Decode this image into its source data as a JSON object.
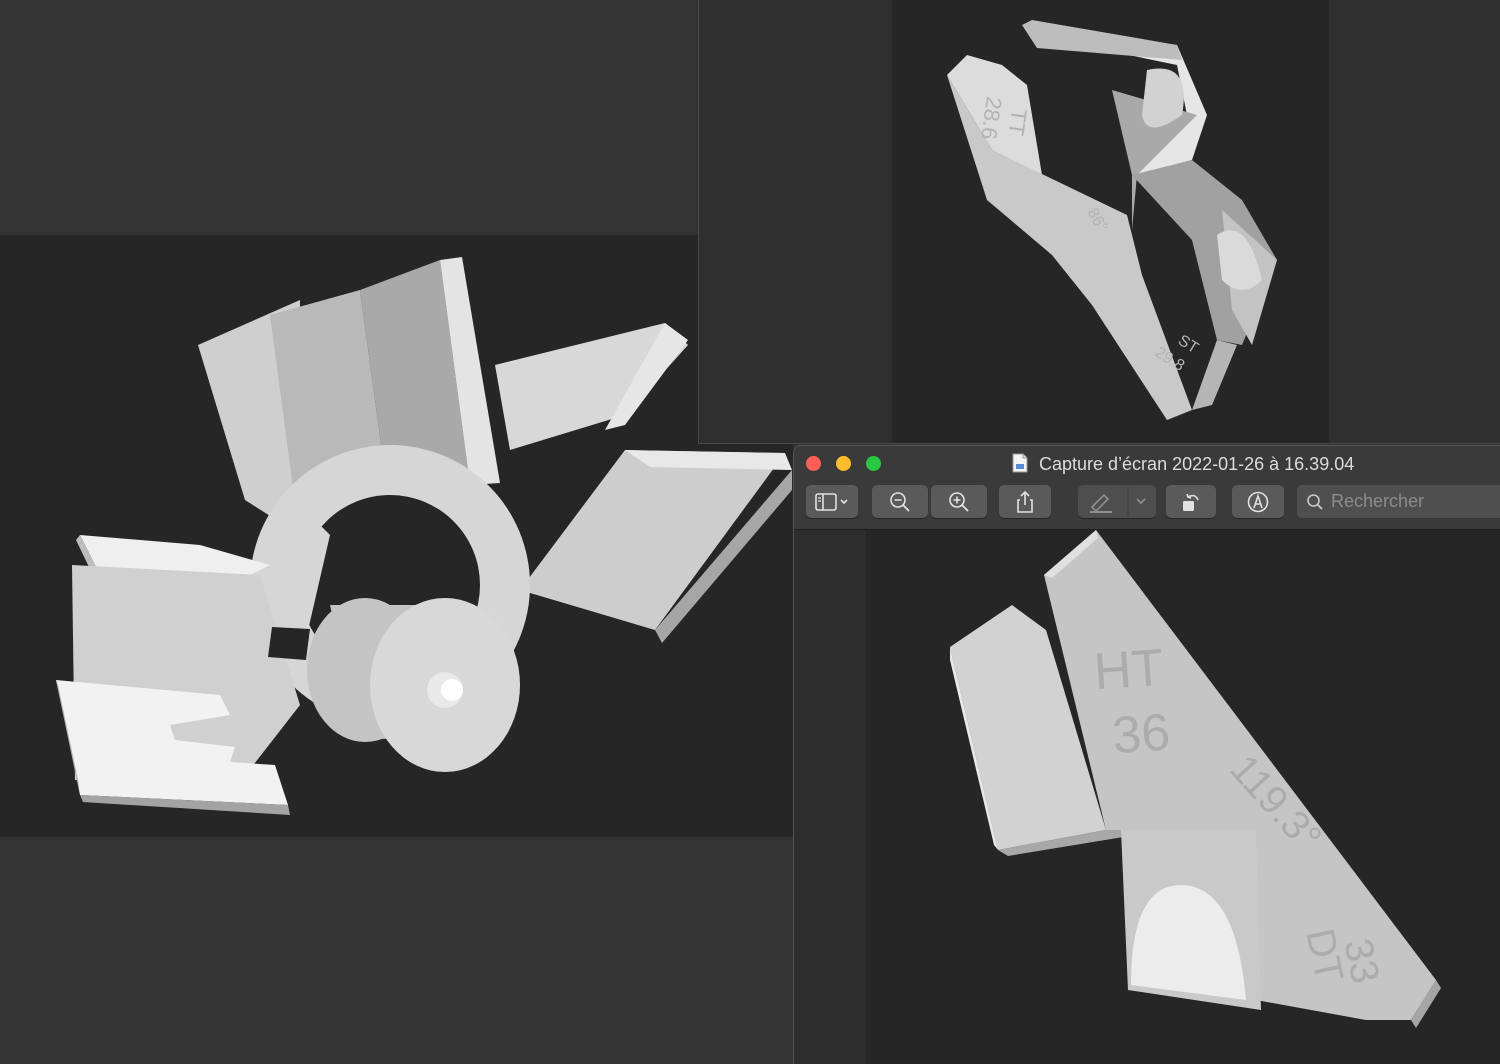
{
  "window_main": {
    "title": "Capture d’écran 2022-01-26 à 16.39.04",
    "traffic_lights": {
      "close": "#fe5f57",
      "minimize": "#febc2e",
      "zoom": "#28c840"
    }
  },
  "toolbar": {
    "sidebar_icon": "sidebar-toggle-icon",
    "zoom_out_icon": "zoom-out-icon",
    "zoom_in_icon": "zoom-in-icon",
    "share_icon": "share-icon",
    "highlight_icon": "highlighter-icon",
    "rotate_icon": "rotate-icon",
    "markup_icon": "markup-icon"
  },
  "search": {
    "placeholder": "Rechercher",
    "value": ""
  },
  "model_labels": {
    "top_right": {
      "l1": "TT",
      "l2": "28.6",
      "angle": "86°",
      "l3": "ST",
      "l4": "29.8"
    },
    "bottom_right": {
      "ht": "HT",
      "ht_val": "36",
      "angle": "119.3°",
      "dt": "DT",
      "dt_val": "33"
    }
  },
  "colors": {
    "canvas_bg": "#262626",
    "model": "#c8c8c8",
    "window_bg": "#333333"
  }
}
